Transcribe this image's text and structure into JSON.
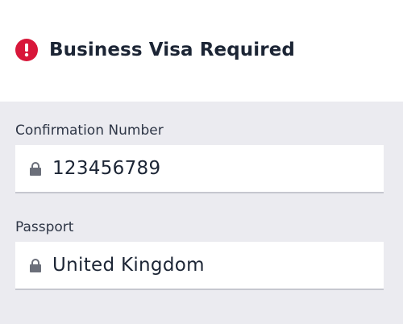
{
  "alert": {
    "icon": "exclamation-circle-icon",
    "title": "Business Visa Required",
    "color": "#d8173a"
  },
  "fields": [
    {
      "label": "Confirmation Number",
      "value": "123456789",
      "icon": "lock-icon",
      "readonly": true
    },
    {
      "label": "Passport",
      "value": "United Kingdom",
      "icon": "lock-icon",
      "readonly": true
    }
  ]
}
